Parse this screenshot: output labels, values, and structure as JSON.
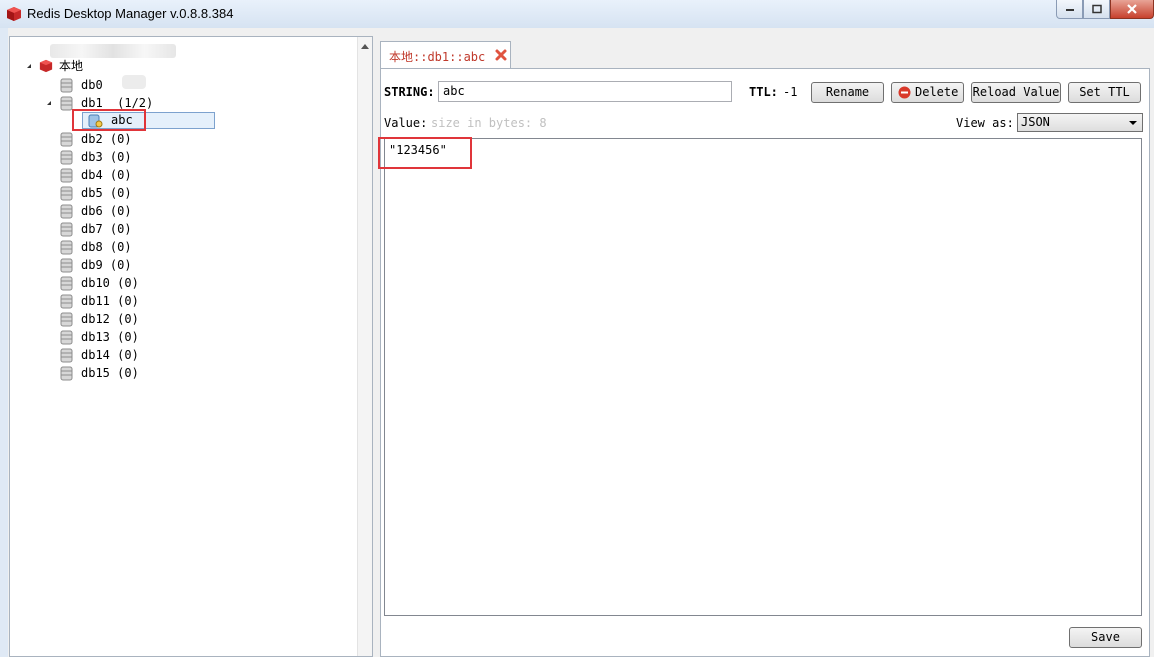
{
  "window": {
    "title": "Redis Desktop Manager v.0.8.8.384"
  },
  "tree": {
    "connection": {
      "label": "本地"
    },
    "databases": [
      {
        "label": "db0",
        "expanded": false
      },
      {
        "label": "db1  (1/2)",
        "expanded": true,
        "keys": [
          {
            "label": "abc",
            "selected": true
          }
        ]
      },
      {
        "label": "db2 (0)"
      },
      {
        "label": "db3 (0)"
      },
      {
        "label": "db4 (0)"
      },
      {
        "label": "db5 (0)"
      },
      {
        "label": "db6 (0)"
      },
      {
        "label": "db7 (0)"
      },
      {
        "label": "db8 (0)"
      },
      {
        "label": "db9 (0)"
      },
      {
        "label": "db10 (0)"
      },
      {
        "label": "db11 (0)"
      },
      {
        "label": "db12 (0)"
      },
      {
        "label": "db13 (0)"
      },
      {
        "label": "db14 (0)"
      },
      {
        "label": "db15 (0)"
      }
    ]
  },
  "tab": {
    "label": "本地::db1::abc"
  },
  "key_editor": {
    "type_label": "STRING:",
    "key_name": "abc",
    "ttl_label": "TTL:",
    "ttl_value": "-1",
    "rename_label": "Rename",
    "delete_label": "Delete",
    "reload_label": "Reload Value",
    "setttl_label": "Set TTL",
    "value_label": "Value:",
    "value_size": "size in bytes: 8",
    "viewas_label": "View as:",
    "viewas_selected": "JSON",
    "value": "\"123456\"",
    "save_label": "Save"
  },
  "colors": {
    "highlight_box": "#e0353a",
    "tab_label": "#c0392b",
    "brand_red": "#c62828"
  }
}
